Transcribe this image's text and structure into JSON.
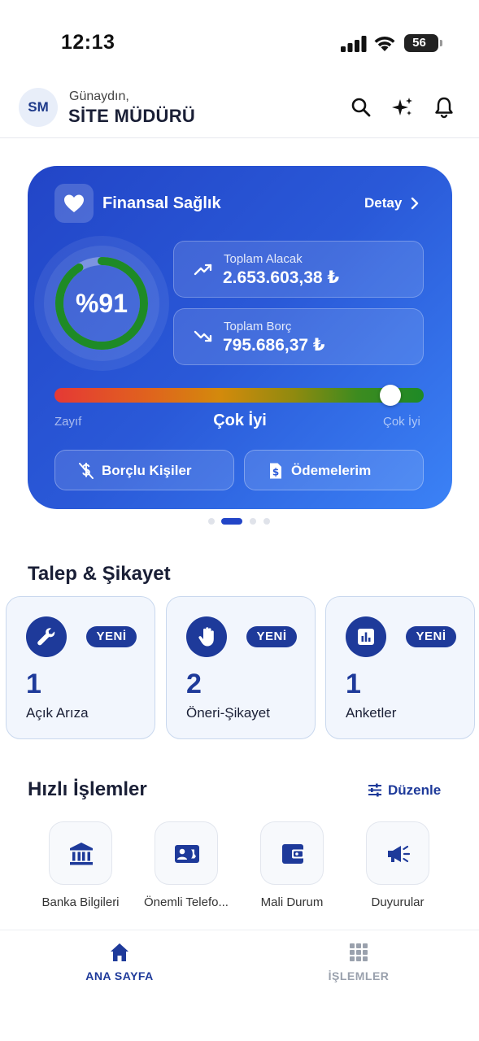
{
  "status_bar": {
    "time": "12:13",
    "battery": "56"
  },
  "header": {
    "avatar_initials": "SM",
    "greeting": "Günaydın,",
    "user_name": "SİTE MÜDÜRÜ",
    "icons": [
      "search-icon",
      "sparkles-icon",
      "bell-icon"
    ]
  },
  "finance_card": {
    "title": "Finansal Sağlık",
    "detail_link": "Detay",
    "health_percent_label": "%91",
    "health_percent": 91,
    "receivable": {
      "label": "Toplam Alacak",
      "value": "2.653.603,38 ₺"
    },
    "debt": {
      "label": "Toplam Borç",
      "value": "795.686,37 ₺"
    },
    "gauge": {
      "min_label": "Zayıf",
      "status_label": "Çok İyi",
      "max_label": "Çok İyi",
      "position": 0.91
    },
    "buttons": {
      "debtors": "Borçlu Kişiler",
      "payments": "Ödemelerim"
    },
    "colors": {
      "card_start": "#2245c7",
      "card_end": "#3b82f6",
      "ring": "#1e8a26"
    }
  },
  "carousel": {
    "count": 4,
    "active_index": 1
  },
  "requests": {
    "title": "Talep & Şikayet",
    "items": [
      {
        "icon": "wrench-icon",
        "badge": "YENİ",
        "count": "1",
        "label": "Açık Arıza"
      },
      {
        "icon": "hand-icon",
        "badge": "YENİ",
        "count": "2",
        "label": "Öneri-Şikayet"
      },
      {
        "icon": "poll-icon",
        "badge": "YENİ",
        "count": "1",
        "label": "Anketler"
      }
    ]
  },
  "quick_actions": {
    "title": "Hızlı İşlemler",
    "edit_label": "Düzenle",
    "items": [
      {
        "icon": "bank-icon",
        "label": "Banka Bilgileri"
      },
      {
        "icon": "contact-phone-icon",
        "label": "Önemli Telefo..."
      },
      {
        "icon": "wallet-icon",
        "label": "Mali Durum"
      },
      {
        "icon": "megaphone-icon",
        "label": "Duyurular"
      }
    ]
  },
  "tab_bar": {
    "home": "ANA SAYFA",
    "operations": "İŞLEMLER",
    "active": "home",
    "colors": {
      "active": "#1e3a9a",
      "inactive": "#9aa1ad"
    }
  }
}
